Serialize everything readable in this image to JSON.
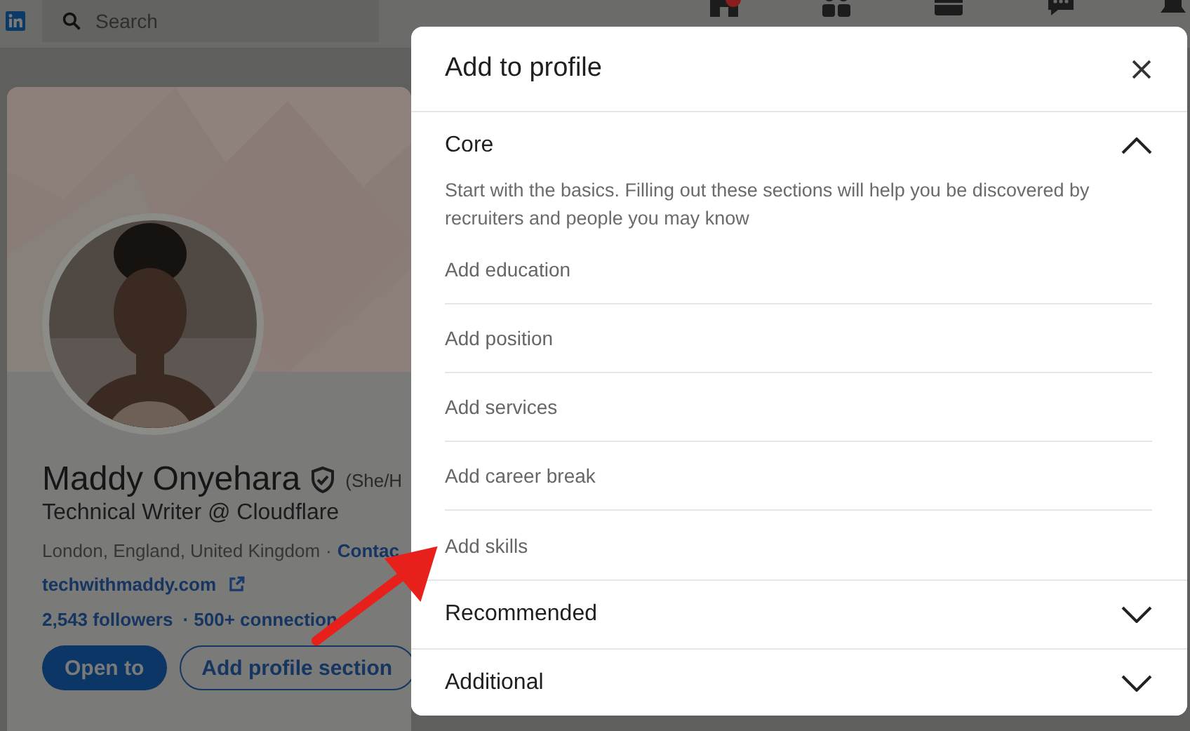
{
  "nav": {
    "search": {
      "placeholder": "Search"
    },
    "icons": [
      {
        "kind": "home",
        "badge": true
      },
      {
        "kind": "network",
        "badge": false
      },
      {
        "kind": "jobs",
        "badge": false
      },
      {
        "kind": "messaging",
        "badge": false
      },
      {
        "kind": "notifications",
        "badge": false
      }
    ]
  },
  "profile": {
    "name": "Maddy Onyehara",
    "verified": true,
    "pronouns": "(She/H",
    "headline": "Technical Writer @ Cloudflare",
    "location": "London, England, United Kingdom",
    "separator": "·",
    "contact": "Contac",
    "website": "techwithmaddy.com",
    "followers": "2,543 followers",
    "connections": "· 500+ connection",
    "buttons": [
      {
        "label": "Open to",
        "kind": "primary"
      },
      {
        "label": "Add profile section",
        "kind": "secondary"
      }
    ]
  },
  "modal": {
    "title": "Add to profile",
    "sections": [
      {
        "title": "Core",
        "expanded": true,
        "description": "Start with the basics. Filling out these sections will help you be discovered by recruiters and people you may know",
        "items": [
          "Add education",
          "Add position",
          "Add services",
          "Add career break",
          "Add skills"
        ]
      },
      {
        "title": "Recommended",
        "expanded": false
      },
      {
        "title": "Additional",
        "expanded": false
      }
    ]
  }
}
